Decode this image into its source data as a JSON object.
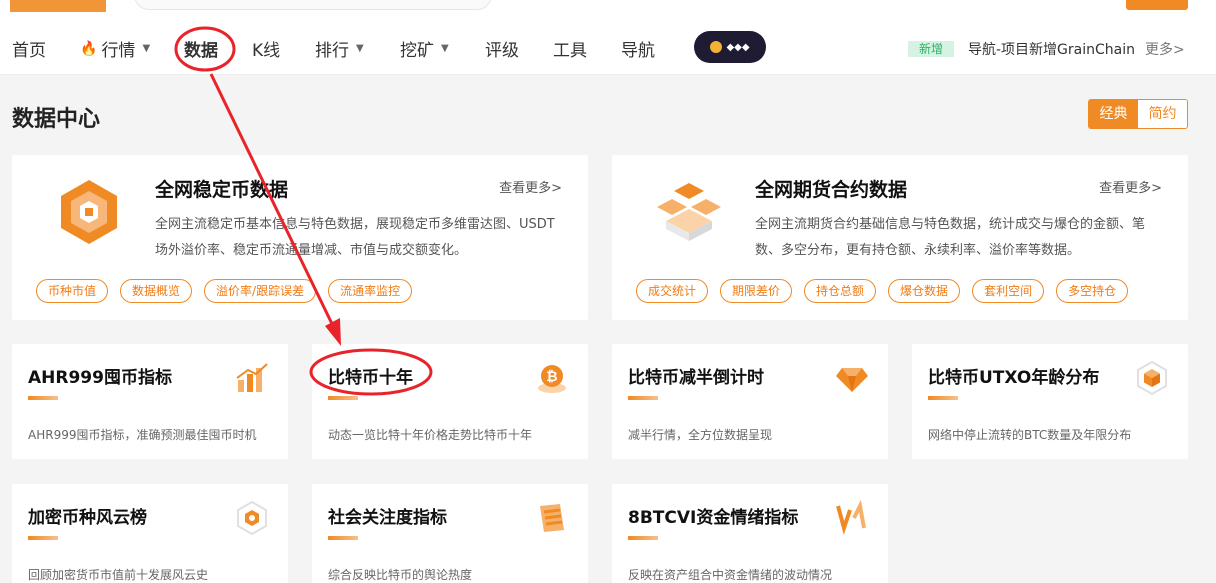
{
  "header": {
    "nav": [
      {
        "label": "首页",
        "caret": ""
      },
      {
        "label": "行情",
        "caret": "▼"
      },
      {
        "label": "数据",
        "caret": ""
      },
      {
        "label": "K线",
        "caret": ""
      },
      {
        "label": "排行",
        "caret": "▼"
      },
      {
        "label": "挖矿",
        "caret": "▼"
      },
      {
        "label": "评级",
        "caret": ""
      },
      {
        "label": "工具",
        "caret": ""
      },
      {
        "label": "导航",
        "caret": ""
      }
    ],
    "news": {
      "tag": "新增",
      "text": "导航-项目新增GrainChain",
      "more": "更多>"
    }
  },
  "page": {
    "title": "数据中心",
    "view_toggle": {
      "classic": "经典",
      "simple": "简约"
    }
  },
  "features": [
    {
      "title": "全网稳定币数据",
      "more": "查看更多>",
      "desc": "全网主流稳定币基本信息与特色数据，展现稳定币多维雷达图、USDT场外溢价率、稳定币流通量增减、市值与成交额变化。",
      "tags": [
        "币种市值",
        "数据概览",
        "溢价率/跟踪误差",
        "流通率监控"
      ]
    },
    {
      "title": "全网期货合约数据",
      "more": "查看更多>",
      "desc": "全网主流期货合约基础信息与特色数据，统计成交与爆仓的金额、笔数、多空分布，更有持仓额、永续利率、溢价率等数据。",
      "tags": [
        "成交统计",
        "期限差价",
        "持仓总额",
        "爆仓数据",
        "套利空间",
        "多空持仓"
      ]
    }
  ],
  "cards": [
    {
      "title": "AHR999囤币指标",
      "desc": "AHR999囤币指标，准确预测最佳囤币时机"
    },
    {
      "title": "比特币十年",
      "desc": "动态一览比特十年价格走势比特币十年"
    },
    {
      "title": "比特币减半倒计时",
      "desc": "减半行情，全方位数据呈现"
    },
    {
      "title": "比特币UTXO年龄分布",
      "desc": "网络中停止流转的BTC数量及年限分布"
    },
    {
      "title": "加密币种风云榜",
      "desc": "回顾加密货币市值前十发展风云史"
    },
    {
      "title": "社会关注度指标",
      "desc": "综合反映比特币的舆论热度"
    },
    {
      "title": "8BTCVI资金情绪指标",
      "desc": "反映在资产组合中资金情绪的波动情况"
    }
  ],
  "colors": {
    "accent": "#f08a24",
    "annotation": "#e8242a",
    "new_tag": "#2bb166"
  }
}
